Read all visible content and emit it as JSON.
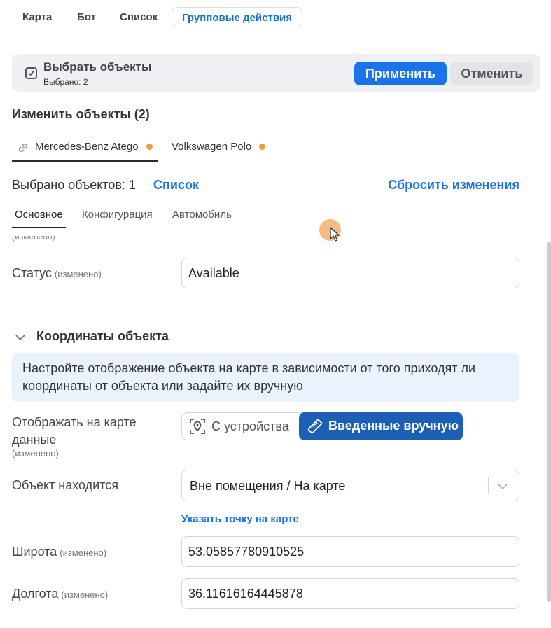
{
  "top_tabs": [
    "Карта",
    "Бот",
    "Список",
    "Групповые действия"
  ],
  "selection_bar": {
    "title": "Выбрать объекты",
    "subtitle": "Выбрано: 2",
    "apply_label": "Применить",
    "cancel_label": "Отменить"
  },
  "edit_section": {
    "title": "Изменить объекты (2)",
    "vehicles": [
      "Mercedes-Benz Atego",
      "Volkswagen Polo"
    ],
    "selected_count": "Выбрано объектов: 1",
    "list_link": "Список",
    "reset_link": "Сбросить изменения",
    "sub_tabs": [
      "Основное",
      "Конфигурация",
      "Автомобиль"
    ],
    "faded_text": "(изменено)"
  },
  "status": {
    "label": "Статус",
    "modified": "(изменено)",
    "value": "Available"
  },
  "coordinates": {
    "title": "Координаты объекта",
    "info": "Настройте отображение объекта на карте в зависимости от того приходят ли координаты от объекта или задайте их вручную",
    "display_label": "Отображать на карте данные",
    "display_modified": "(изменено)",
    "option_device": "С устройства",
    "option_manual": "Введенные вручную",
    "location_label": "Объект находится",
    "location_value": "Вне помещения / На карте",
    "map_link": "Указать точку на карте",
    "latitude_label": "Широта",
    "latitude_modified": "(изменено)",
    "latitude_value": "53.05857780910525",
    "longitude_label": "Долгота",
    "longitude_modified": "(изменено)",
    "longitude_value": "36.11616164445878"
  },
  "colors": {
    "accent": "#1a73e8",
    "segment_active": "#1c5fb5",
    "modified_dot": "#e8a13a",
    "info_bg": "#e9f2fd"
  },
  "icons": [
    "checkbox-icon",
    "link-icon",
    "chevron-down-icon",
    "location-scan-icon",
    "ruler-icon",
    "select-chevron-icon",
    "mouse-cursor-icon"
  ]
}
